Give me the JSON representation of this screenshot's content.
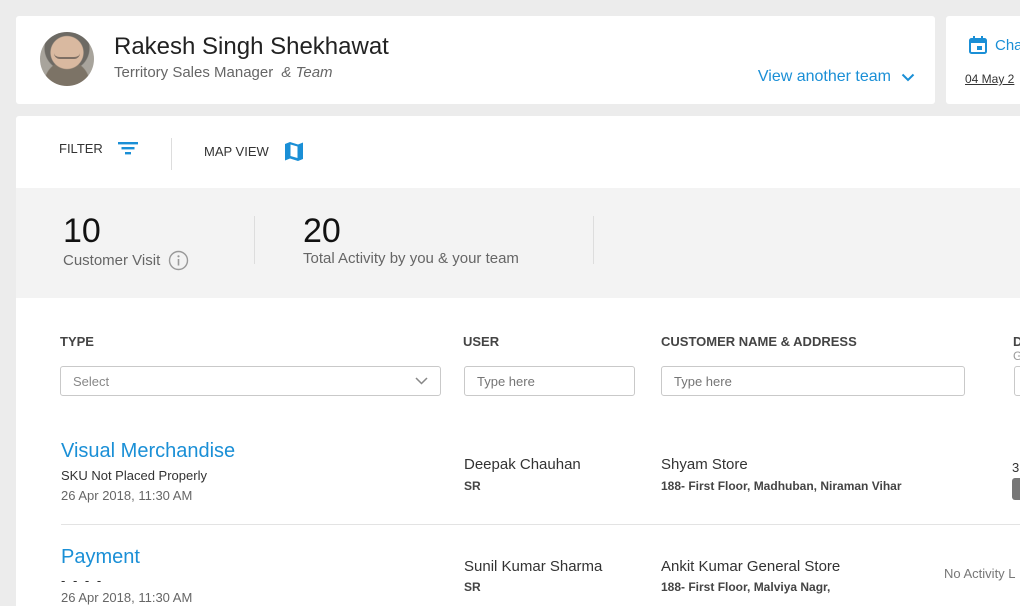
{
  "profile": {
    "name": "Rakesh Singh Shekhawat",
    "role": "Territory Sales Manager",
    "team_suffix": "& Team",
    "view_team_label": "View another team"
  },
  "date_panel": {
    "label": "Cha",
    "date": "04 May 2"
  },
  "toolbar": {
    "filter_label": "FILTER",
    "map_view_label": "MAP VIEW"
  },
  "stats": [
    {
      "value": "10",
      "label": "Customer Visit"
    },
    {
      "value": "20",
      "label": "Total Activity by you & your team"
    }
  ],
  "filters": {
    "type_header": "TYPE",
    "type_placeholder": "Select",
    "user_header": "USER",
    "user_placeholder": "Type here",
    "customer_header": "CUSTOMER NAME & ADDRESS",
    "customer_placeholder": "Type here",
    "extra_header": "D",
    "extra_sub": "G"
  },
  "rows": [
    {
      "title": "Visual Merchandise",
      "subtitle": "SKU Not Placed Properly",
      "time": "26 Apr 2018, 11:30 AM",
      "user_name": "Deepak Chauhan",
      "user_role": "SR",
      "customer_name": "Shyam Store",
      "customer_address": "188- First Floor, Madhuban, Niraman Vihar",
      "extra": "3"
    },
    {
      "title": "Payment",
      "subtitle": "- - - -",
      "time": "26 Apr 2018, 11:30 AM",
      "user_name": "Sunil Kumar Sharma",
      "user_role": "SR",
      "customer_name": "Ankit Kumar General Store",
      "customer_address": "188- First Floor, Malviya Nagr,",
      "extra": "No Activity L"
    }
  ],
  "colors": {
    "accent": "#1a8fd6",
    "background": "#ececec",
    "stats_band": "#f3f3f3"
  }
}
